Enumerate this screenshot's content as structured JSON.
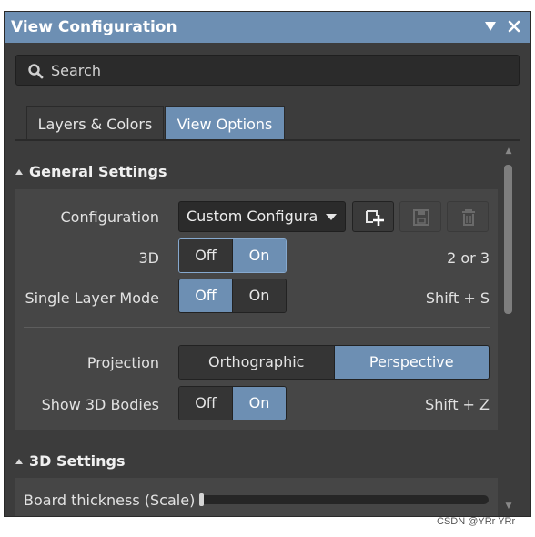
{
  "window": {
    "title": "View Configuration"
  },
  "search": {
    "placeholder": "Search"
  },
  "tabs": [
    {
      "label": "Layers & Colors",
      "active": false
    },
    {
      "label": "View Options",
      "active": true
    }
  ],
  "general_settings": {
    "title": "General Settings",
    "configuration": {
      "label": "Configuration",
      "value": "Custom Configura"
    },
    "mode_3d": {
      "label": "3D",
      "options": [
        "Off",
        "On"
      ],
      "selected": "On",
      "shortcut": "2 or 3"
    },
    "single_layer": {
      "label": "Single Layer Mode",
      "options": [
        "Off",
        "On"
      ],
      "selected": "Off",
      "shortcut": "Shift + S"
    },
    "projection": {
      "label": "Projection",
      "options": [
        "Orthographic",
        "Perspective"
      ],
      "selected": "Perspective"
    },
    "show_3d_bodies": {
      "label": "Show 3D Bodies",
      "options": [
        "Off",
        "On"
      ],
      "selected": "On",
      "shortcut": "Shift + Z"
    }
  },
  "settings_3d": {
    "title": "3D Settings",
    "board_thickness": {
      "label": "Board thickness (Scale)",
      "value": 0
    }
  },
  "watermark": "CSDN @YRr YRr",
  "colors": {
    "accent": "#6d8fb3",
    "panel": "#3c3c3c",
    "card": "#464646"
  }
}
